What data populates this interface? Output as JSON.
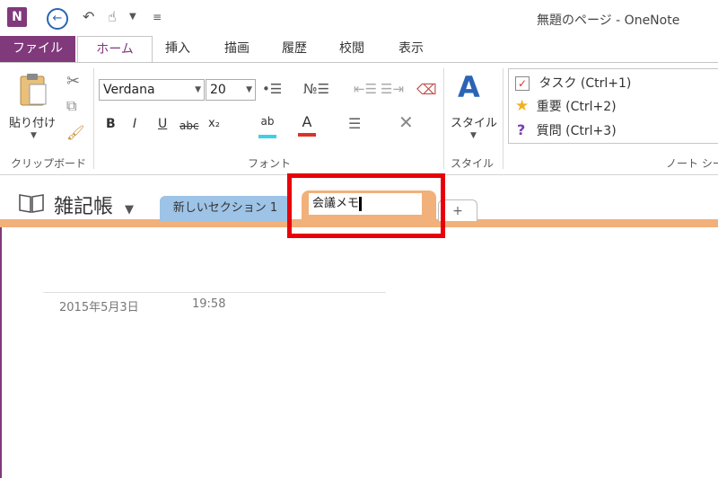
{
  "window": {
    "title": "無題のページ - OneNote",
    "app_logo": "N"
  },
  "tabs": {
    "file": "ファイル",
    "home": "ホーム",
    "insert": "挿入",
    "draw": "描画",
    "history": "履歴",
    "review": "校閲",
    "view": "表示"
  },
  "clipboard": {
    "paste_label": "貼り付け",
    "group_label": "クリップボード"
  },
  "font": {
    "family": "Verdana",
    "size": "20",
    "group_label": "フォント",
    "bold": "B",
    "italic": "I",
    "underline": "U",
    "strike": "abc",
    "subscript": "x₂",
    "highlight_glyph": "ab",
    "font_color_glyph": "A"
  },
  "styles": {
    "label": "スタイル",
    "group_label": "スタイル"
  },
  "tags": {
    "items": [
      {
        "label": "タスク (Ctrl+1)",
        "icon": "checkbox-icon"
      },
      {
        "label": "重要 (Ctrl+2)",
        "icon": "star-icon"
      },
      {
        "label": "質問 (Ctrl+3)",
        "icon": "question-icon"
      }
    ],
    "group_label": "ノート シー"
  },
  "notebook": {
    "name": "雑記帳",
    "sections": [
      {
        "label": "新しいセクション 1"
      }
    ],
    "editing_section_value": "会議メモ",
    "add_section": "+"
  },
  "page": {
    "date": "2015年5月3日",
    "time": "19:58"
  },
  "colors": {
    "accent": "#80397b",
    "section_blue": "#9dc3e6",
    "section_orange": "#f2b07a",
    "highlight_red": "#e8000b"
  }
}
